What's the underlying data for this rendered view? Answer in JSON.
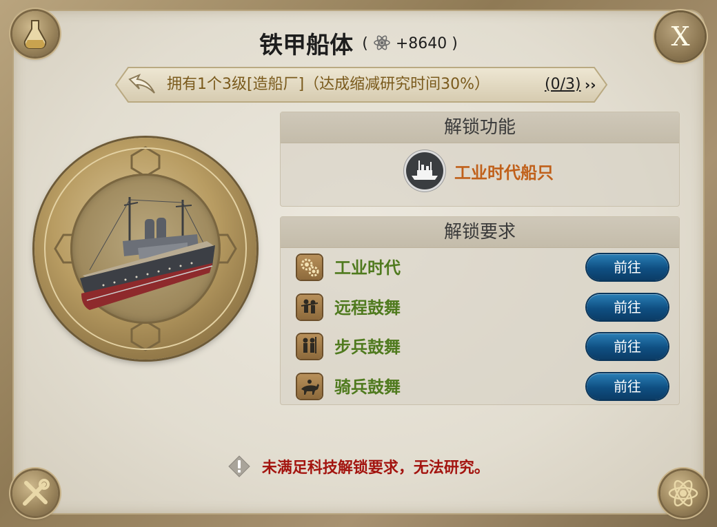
{
  "header": {
    "title": "铁甲船体",
    "cost_open": "(",
    "cost_value": "+8640",
    "cost_close": ")",
    "cost_icon": "atom-icon"
  },
  "banner": {
    "requirement_text": "拥有1个3级[造船厂]（达成缩减研究时间30%）",
    "progress": "(0/3)",
    "chevrons": "››"
  },
  "unlock_feature": {
    "heading": "解锁功能",
    "item_label": "工业时代船只",
    "item_icon": "battleship-icon"
  },
  "unlock_requirements": {
    "heading": "解锁要求",
    "items": [
      {
        "label": "工业时代",
        "icon": "gears-icon",
        "button": "前往"
      },
      {
        "label": "远程鼓舞",
        "icon": "ranged-soldiers-icon",
        "button": "前往"
      },
      {
        "label": "步兵鼓舞",
        "icon": "infantry-icon",
        "button": "前往"
      },
      {
        "label": "骑兵鼓舞",
        "icon": "cavalry-icon",
        "button": "前往"
      }
    ]
  },
  "warning": {
    "text": "未满足科技解锁要求，无法研究。",
    "icon": "exclamation-icon"
  },
  "controls": {
    "close_label": "X",
    "corner_icons": [
      "flask-icon",
      "tools-icon",
      "atom-icon"
    ]
  },
  "colors": {
    "requirement_green": "#4f7a1e",
    "feature_orange": "#c0601a",
    "warning_red": "#a3140f",
    "button_blue": "#0f4f82"
  }
}
